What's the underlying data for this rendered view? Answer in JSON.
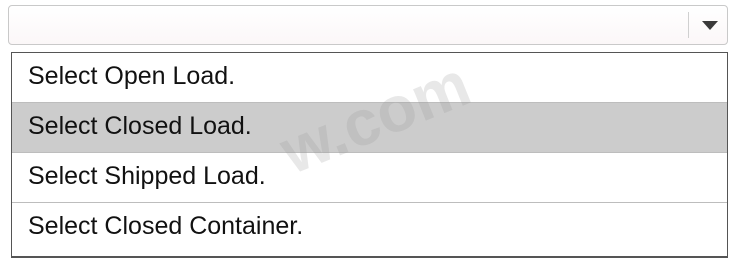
{
  "combo": {
    "value": "",
    "arrow_icon": "caret-down-icon"
  },
  "options": [
    {
      "label": "Select Open Load.",
      "selected": false
    },
    {
      "label": "Select Closed Load.",
      "selected": true
    },
    {
      "label": "Select Shipped Load.",
      "selected": false
    },
    {
      "label": "Select Closed Container.",
      "selected": false
    }
  ],
  "colors": {
    "selected_row": "#cccccc",
    "list_border": "#555555"
  },
  "watermark": {
    "text": "w.com"
  }
}
